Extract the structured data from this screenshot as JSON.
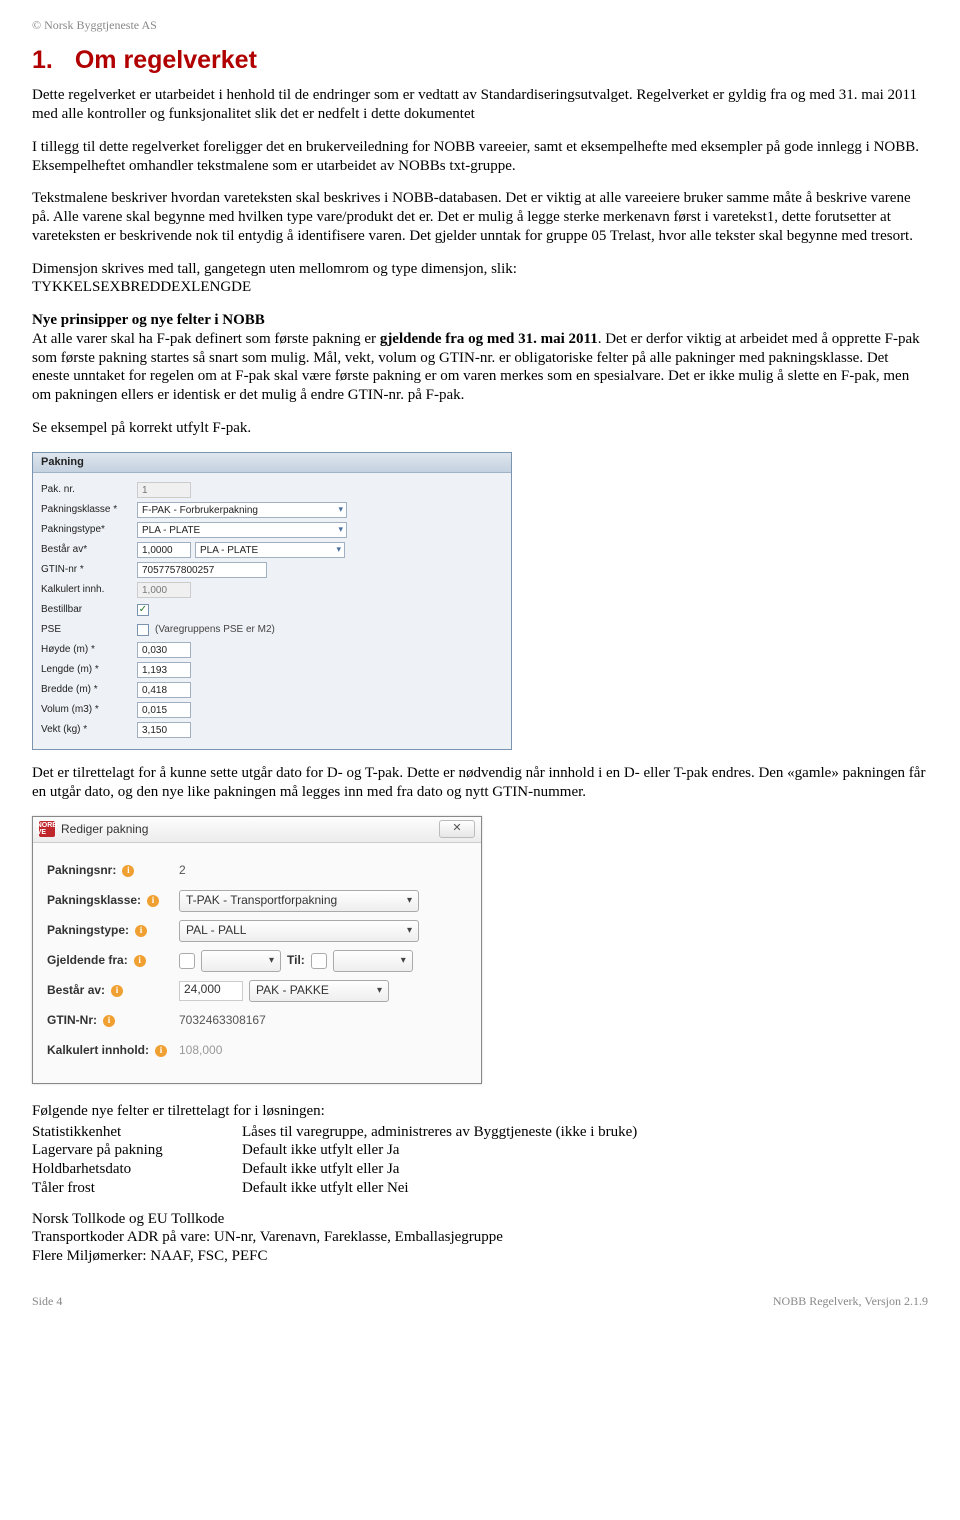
{
  "header_copyright": "© Norsk Byggtjeneste AS",
  "h1_num": "1.",
  "h1_text": "Om regelverket",
  "para1": "Dette regelverket er utarbeidet i henhold til de endringer som er vedtatt av Standardiseringsutvalget. Regelverket er gyldig fra og med 31. mai 2011 med alle kontroller og funksjonalitet slik det er nedfelt i dette dokumentet",
  "para2": "I tillegg til dette regelverket foreligger det en brukerveiledning for NOBB vareeier, samt et eksempelhefte med eksempler på gode innlegg i NOBB. Eksempelheftet omhandler tekstmalene som er utarbeidet av NOBBs txt-gruppe.",
  "para3": "Tekstmalene beskriver hvordan vareteksten skal beskrives i NOBB-databasen. Det er viktig at alle vareeiere bruker samme måte å beskrive varene på. Alle varene skal begynne med hvilken type vare/produkt det er. Det er mulig å legge sterke merkenavn først i varetekst1, dette forutsetter at vareteksten er beskrivende nok til entydig å identifisere varen. Det gjelder unntak for gruppe 05 Trelast, hvor alle tekster skal begynne med tresort.",
  "para4a": "Dimensjon skrives med tall, gangetegn uten mellomrom og type dimensjon, slik:",
  "para4b": "TYKKELSEXBREDDEXLENGDE",
  "sub_heading": "Nye prinsipper og nye felter i NOBB",
  "para5a": "At alle varer skal ha F-pak definert som første pakning er ",
  "para5b": "gjeldende fra og med 31. mai 2011",
  "para5c": ". Det er derfor viktig at arbeidet med å opprette F-pak som første pakning startes så snart som mulig. Mål, vekt, volum og GTIN-nr. er obligatoriske felter på alle pakninger med pakningsklasse. Det eneste unntaket for regelen om at F-pak skal være første pakning er om varen merkes som en spesialvare. Det er ikke mulig å slette en F-pak, men om pakningen ellers er identisk er det mulig å endre GTIN-nr. på F-pak.",
  "para6": "Se eksempel på korrekt utfylt F-pak.",
  "form1": {
    "title": "Pakning",
    "rows": {
      "pak_nr_label": "Pak. nr.",
      "pak_nr_value": "1",
      "pakningsklasse_label": "Pakningsklasse *",
      "pakningsklasse_value": "F-PAK - Forbrukerpakning",
      "pakningstype_label": "Pakningstype*",
      "pakningstype_value": "PLA - PLATE",
      "bestar_av_label": "Består av*",
      "bestar_av_qty": "1,0000",
      "bestar_av_unit": "PLA - PLATE",
      "gtin_label": "GTIN-nr *",
      "gtin_value": "7057757800257",
      "kalkulert_label": "Kalkulert innh.",
      "kalkulert_value": "1,000",
      "bestillbar_label": "Bestillbar",
      "bestillbar_check": "✓",
      "pse_label": "PSE",
      "pse_note": "(Varegruppens PSE er M2)",
      "hoyde_label": "Høyde (m) *",
      "hoyde_value": "0,030",
      "lengde_label": "Lengde (m) *",
      "lengde_value": "1,193",
      "bredde_label": "Bredde (m) *",
      "bredde_value": "0,418",
      "volum_label": "Volum (m3) *",
      "volum_value": "0,015",
      "vekt_label": "Vekt (kg) *",
      "vekt_value": "3,150"
    }
  },
  "para7": "Det er tilrettelagt for å kunne sette utgår dato for D- og T-pak. Dette er nødvendig når innhold i en D- eller T-pak endres. Den «gamle» pakningen får en utgår dato, og den nye like pakningen må legges inn med fra dato og nytt GTIN-nummer.",
  "dialog2": {
    "icon": "NORB VE",
    "title": "Rediger pakning",
    "close": "✕",
    "rows": {
      "pakningsnr_label": "Pakningsnr:",
      "pakningsnr_value": "2",
      "pakningsklasse_label": "Pakningsklasse:",
      "pakningsklasse_value": "T-PAK - Transportforpakning",
      "pakningstype_label": "Pakningstype:",
      "pakningstype_value": "PAL - PALL",
      "gjeldende_label": "Gjeldende fra:",
      "til_label": "Til:",
      "bestar_av_label": "Består av:",
      "bestar_av_qty": "24,000",
      "bestar_av_unit": "PAK - PAKKE",
      "gtin_label": "GTIN-Nr:",
      "gtin_value": "7032463308167",
      "kalkulert_label": "Kalkulert innhold:",
      "kalkulert_value": "108,000"
    }
  },
  "fields_intro": "Følgende nye felter er tilrettelagt for i løsningen:",
  "fields": [
    {
      "name": "Statistikkenhet",
      "desc": "Låses til varegruppe, administreres av Byggtjeneste (ikke i bruke)"
    },
    {
      "name": "Lagervare på pakning",
      "desc": "Default ikke utfylt eller Ja"
    },
    {
      "name": "Holdbarhetsdato",
      "desc": "Default ikke utfylt eller Ja"
    },
    {
      "name": "Tåler frost",
      "desc": "Default ikke utfylt eller Nei"
    }
  ],
  "extra_lines": [
    "Norsk Tollkode og EU Tollkode",
    "Transportkoder ADR på vare: UN-nr, Varenavn, Fareklasse, Emballasjegruppe",
    "Flere Miljømerker: NAAF, FSC, PEFC"
  ],
  "footer_left": "Side 4",
  "footer_right": "NOBB Regelverk, Versjon 2.1.9"
}
